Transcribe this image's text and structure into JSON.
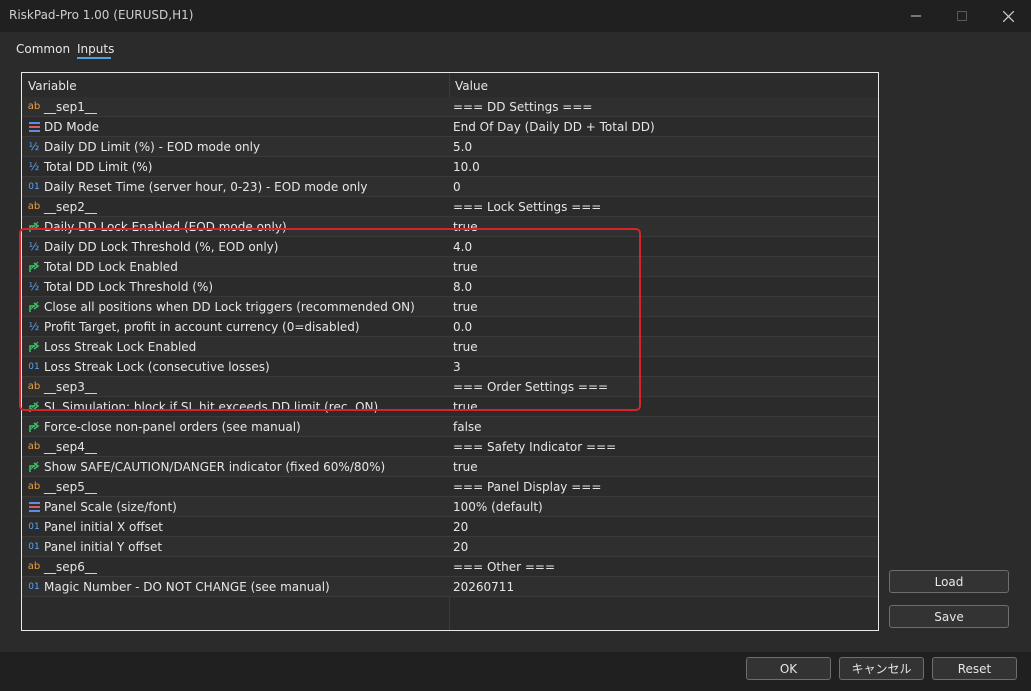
{
  "window": {
    "title": "RiskPad-Pro 1.00 (EURUSD,H1)"
  },
  "tabs": [
    {
      "label": "Common"
    },
    {
      "label": "Inputs"
    }
  ],
  "grid": {
    "header": {
      "variable": "Variable",
      "value": "Value"
    },
    "rows": [
      {
        "icon": "string-icon",
        "variable": "__sep1__",
        "value": "=== DD Settings ==="
      },
      {
        "icon": "enum-icon",
        "variable": "DD Mode",
        "value": "End Of Day (Daily DD + Total DD)"
      },
      {
        "icon": "double-icon",
        "variable": "Daily DD Limit (%) - EOD mode only",
        "value": "5.0"
      },
      {
        "icon": "double-icon",
        "variable": "Total DD Limit (%)",
        "value": "10.0"
      },
      {
        "icon": "int-icon",
        "variable": "Daily Reset Time (server hour, 0-23) - EOD mode only",
        "value": "0"
      },
      {
        "icon": "string-icon",
        "variable": "__sep2__",
        "value": "=== Lock Settings ==="
      },
      {
        "icon": "bool-icon",
        "variable": "Daily DD Lock Enabled (EOD mode only)",
        "value": "true"
      },
      {
        "icon": "double-icon",
        "variable": "Daily DD Lock Threshold (%, EOD only)",
        "value": "4.0"
      },
      {
        "icon": "bool-icon",
        "variable": "Total DD Lock Enabled",
        "value": "true"
      },
      {
        "icon": "double-icon",
        "variable": "Total DD Lock Threshold (%)",
        "value": "8.0"
      },
      {
        "icon": "bool-icon",
        "variable": "Close all positions when DD Lock triggers (recommended ON)",
        "value": "true"
      },
      {
        "icon": "double-icon",
        "variable": "Profit Target, profit in account currency (0=disabled)",
        "value": "0.0"
      },
      {
        "icon": "bool-icon",
        "variable": "Loss Streak Lock Enabled",
        "value": "true"
      },
      {
        "icon": "int-icon",
        "variable": "Loss Streak Lock (consecutive losses)",
        "value": "3"
      },
      {
        "icon": "string-icon",
        "variable": "__sep3__",
        "value": "=== Order Settings ==="
      },
      {
        "icon": "bool-icon",
        "variable": "SL Simulation: block if SL hit exceeds DD limit (rec. ON)",
        "value": "true"
      },
      {
        "icon": "bool-icon",
        "variable": "Force-close non-panel orders (see manual)",
        "value": "false"
      },
      {
        "icon": "string-icon",
        "variable": "__sep4__",
        "value": "=== Safety Indicator ==="
      },
      {
        "icon": "bool-icon",
        "variable": "Show SAFE/CAUTION/DANGER indicator (fixed 60%/80%)",
        "value": "true"
      },
      {
        "icon": "string-icon",
        "variable": "__sep5__",
        "value": "=== Panel Display ==="
      },
      {
        "icon": "enum-icon",
        "variable": "Panel Scale (size/font)",
        "value": "100% (default)"
      },
      {
        "icon": "int-icon",
        "variable": "Panel initial X offset",
        "value": "20"
      },
      {
        "icon": "int-icon",
        "variable": "Panel initial Y offset",
        "value": "20"
      },
      {
        "icon": "string-icon",
        "variable": "__sep6__",
        "value": "=== Other ==="
      },
      {
        "icon": "int-icon",
        "variable": "Magic Number - DO NOT CHANGE (see manual)",
        "value": "20260711"
      }
    ]
  },
  "side_buttons": {
    "load": "Load",
    "save": "Save"
  },
  "footer_buttons": {
    "ok": "OK",
    "cancel": "キャンセル",
    "reset": "Reset"
  },
  "colors": {
    "accent": "#4ea1e6",
    "highlight": "#d8232a",
    "string_icon": "#e8a04a",
    "number_icon": "#5aa6ff",
    "bool_icon": "#3cc46a"
  }
}
